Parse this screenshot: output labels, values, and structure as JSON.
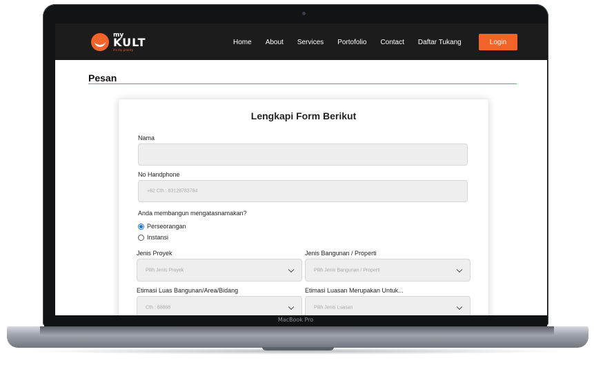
{
  "device": {
    "label": "MacBook Pro"
  },
  "nav": {
    "logo": {
      "small": "my",
      "big": "KULT",
      "tagline": "it's my priority"
    },
    "items": [
      "Home",
      "About",
      "Services",
      "Portofolio",
      "Contact",
      "Daftar Tukang"
    ],
    "login_label": "Login"
  },
  "page": {
    "title": "Pesan"
  },
  "form": {
    "title": "Lengkapi Form Berikut",
    "nama_label": "Nama",
    "nama_value": "",
    "phone_label": "No Handphone",
    "phone_placeholder": "+62  Cth : 83128783784",
    "question": "Anda membangun mengatasnamakan?",
    "options": [
      {
        "label": "Perseorangan",
        "selected": true
      },
      {
        "label": "Instansi",
        "selected": false
      }
    ],
    "jenis_proyek_label": "Jenis Proyek",
    "jenis_proyek_placeholder": "Pilih Jenis Proyek",
    "jenis_bangunan_label": "Jenis Bangunan / Properti",
    "jenis_bangunan_placeholder": "Pilih Jenis  Bangunan / Properti",
    "luas_label": "Etimasi Luas Bangunan/Area/Bidang",
    "luas_placeholder": "Cth : 88888",
    "luasan_label": "Etimasi Luasan Merupakan Untuk...",
    "luasan_placeholder": "Pilih Jenis  Luasan"
  },
  "colors": {
    "accent": "#f0642a",
    "navbar": "#1c1c1c",
    "radio": "#1a73e8"
  }
}
